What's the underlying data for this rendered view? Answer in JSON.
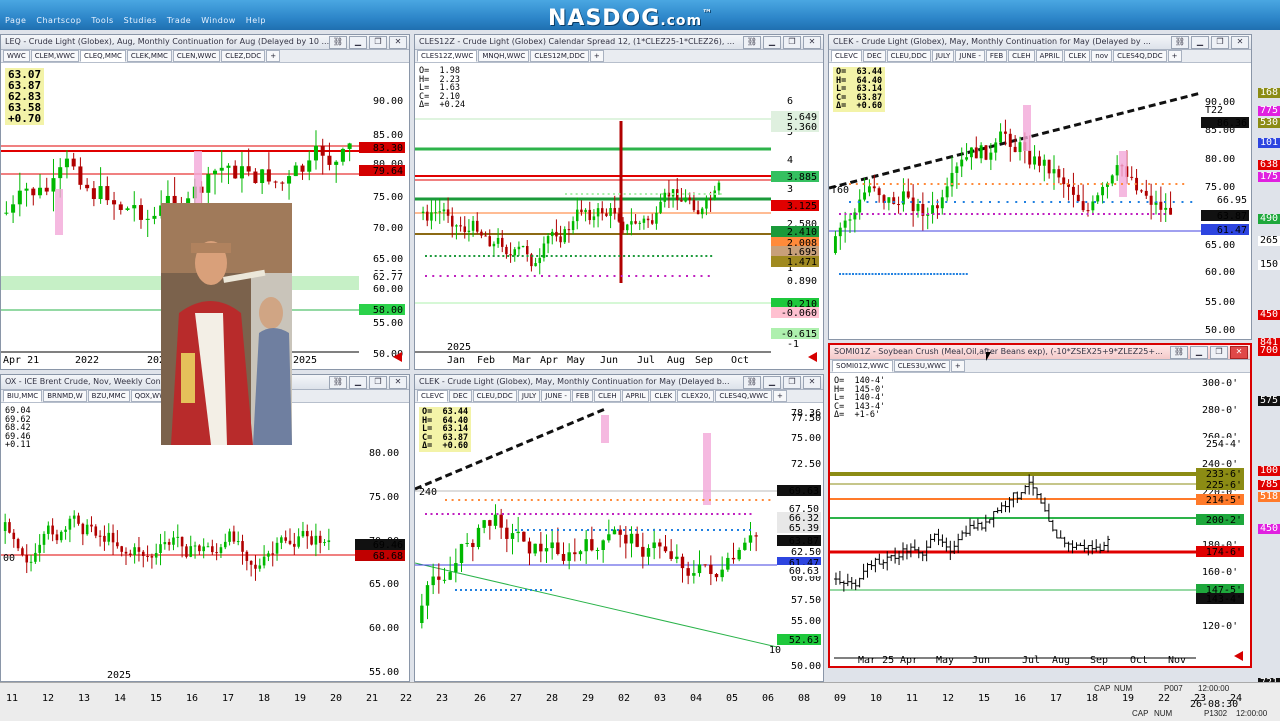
{
  "banner": {
    "logo_main": "NASDOG",
    "logo_suffix": ".com",
    "logo_tm": "™",
    "menu": [
      "Page",
      "Chartscop",
      "Tools",
      "Studies",
      "Trade",
      "Window",
      "Help"
    ]
  },
  "colors": {
    "up_candle": "#00c800",
    "down_candle": "#c80000",
    "red_line": "#e00000",
    "green_band": "#2db34a",
    "olive": "#8c8c14",
    "orange": "#ff7a2a",
    "blue_line": "#4040e0"
  },
  "windows": [
    {
      "id": "w1",
      "title": "LEQ - Crude Light (Globex), Aug, Monthly Continuation for Aug (Delayed by 10 ...",
      "tabs": [
        "WWC",
        "CLEM,WWC",
        "CLEQ,MMC",
        "CLEK,MMC",
        "CLEN,WWC",
        "CLEZ,DDC",
        "+"
      ],
      "ohlc": [
        "63.07",
        "63.87",
        "62.83",
        "63.58",
        "+0.70"
      ],
      "y_ticks": [
        "90.00",
        "85.00",
        "80.00",
        "75.00",
        "70.00",
        "65.00",
        "60.00",
        "55.00",
        "50.00"
      ],
      "right_labels": [
        {
          "text": "83.30",
          "color": "#d40000"
        },
        {
          "text": "79.64",
          "color": "#d40000"
        },
        {
          "text": "62.59",
          "color": "#111"
        },
        {
          "text": "62.77",
          "color": "#5a5a5a"
        },
        {
          "text": "58.00",
          "color": "#1eaa3c"
        }
      ],
      "x_labels": [
        "Apr 21",
        "2022",
        "202",
        "2025"
      ]
    },
    {
      "id": "w2",
      "title": "CLES12Z - Crude Light (Globex) Calendar Spread 12, (1*CLEZ25-1*CLEZ26), ...",
      "tabs": [
        "CLES12Z,WWC",
        "MNQH,WWC",
        "CLES12M,DDC",
        "+"
      ],
      "ohlc": [
        "O=  1.98",
        "H=  2.23",
        "L=  1.63",
        "C=  2.10",
        "Δ=  +0.24"
      ],
      "y_ticks": [
        "6",
        "5",
        "4",
        "3",
        "2",
        "1",
        "0",
        "-1"
      ],
      "right_labels": [
        {
          "text": "5.649",
          "color": "#000",
          "bg": "#dff0df"
        },
        {
          "text": "5.360",
          "color": "#000",
          "bg": "#dff0df"
        },
        {
          "text": "3.885",
          "color": "#000",
          "bg": "#35c060"
        },
        {
          "text": "3.125",
          "color": "#fff",
          "bg": "#e00000"
        },
        {
          "text": "2.580",
          "color": "#000",
          "bg": "#fff"
        },
        {
          "text": "2.410",
          "color": "#fff",
          "bg": "#1a9a3a"
        },
        {
          "text": "2.008",
          "color": "#000",
          "bg": "#ff8a3a"
        },
        {
          "text": "1.695",
          "color": "#000",
          "bg": "#c8a07a"
        },
        {
          "text": "1.471",
          "color": "#000",
          "bg": "#a08a20"
        },
        {
          "text": "0.890",
          "color": "#000",
          "bg": "#fff"
        },
        {
          "text": "0.210",
          "color": "#fff",
          "bg": "#1ec83c"
        },
        {
          "text": "-0.060",
          "color": "#000",
          "bg": "#ffc0d0"
        },
        {
          "text": "-0.615",
          "color": "#000",
          "bg": "#aef0ae"
        }
      ],
      "year": "2025",
      "x_labels": [
        "Jan",
        "Feb",
        "Mar",
        "Apr",
        "May",
        "Jun",
        "Jul",
        "Aug",
        "Sep",
        "Oct"
      ]
    },
    {
      "id": "w3",
      "title": "CLEK - Crude Light (Globex), May, Monthly Continuation for May (Delayed by ...",
      "tabs": [
        "CLEVC",
        "DEC",
        "CLEU,DDC",
        "JULY",
        "JUNE -",
        "FEB",
        "CLEH",
        "APRIL",
        "CLEK",
        "nov",
        "CLES4Q,DDC",
        "+"
      ],
      "ohlc": [
        "O=  63.44",
        "H=  64.40",
        "L=  63.14",
        "C=  63.87",
        "Δ=  +0.60"
      ],
      "y_ticks": [
        "90.00",
        "85.00",
        "80.00",
        "75.00",
        "70.00",
        "65.00",
        "60.00",
        "55.00",
        "50.00",
        "45.00"
      ],
      "right_labels": [
        {
          "text": "86.36",
          "color": "#fff",
          "bg": "#111"
        },
        {
          "text": "66.95",
          "color": "#1a5ad0",
          "bg": "#fff"
        },
        {
          "text": "63.87",
          "color": "#fff",
          "bg": "#111"
        },
        {
          "text": "61.47",
          "color": "#fff",
          "bg": "#2d45e0"
        }
      ],
      "edge_labels": [
        "T22",
        "T60"
      ]
    },
    {
      "id": "w4",
      "title": "OX - ICE Brent Crude, Nov, Weekly Continuation",
      "tabs": [
        "BIU,MMC",
        "BRNMD,W",
        "BZU,MMC",
        "QOX,WWC",
        "+"
      ],
      "ohlc": [
        "69.04",
        "69.62",
        "68.42",
        "69.46",
        "+0.11"
      ],
      "y_ticks": [
        "80.00",
        "75.00",
        "70.00",
        "65.00",
        "60.00",
        "55.00"
      ],
      "right_labels": [
        {
          "text": "69.46",
          "color": "#fff",
          "bg": "#111"
        },
        {
          "text": "68.68",
          "color": "#fff",
          "bg": "#c00000"
        }
      ],
      "year": "2025",
      "edge_label": "00"
    },
    {
      "id": "w5",
      "title": "CLEK - Crude Light (Globex), May, Monthly Continuation for May (Delayed b...",
      "tabs": [
        "CLEVC",
        "DEC",
        "CLEU,DDC",
        "JULY",
        "JUNE -",
        "FEB",
        "CLEH",
        "APRIL",
        "CLEK",
        "CLEX20,",
        "CLES4Q,WWC",
        "+"
      ],
      "ohlc": [
        "O=  63.44",
        "H=  64.40",
        "L=  63.14",
        "C=  63.87",
        "Δ=  +0.60"
      ],
      "y_ticks": [
        "78.36",
        "77.50",
        "75.00",
        "72.50",
        "70.00",
        "67.50",
        "65.00",
        "62.50",
        "60.00",
        "57.50",
        "55.00",
        "52.50",
        "50.00"
      ],
      "right_labels": [
        {
          "text": "69.63",
          "color": "#fff",
          "bg": "#111"
        },
        {
          "text": "67.50",
          "color": "#1a5ad0",
          "bg": "#fff"
        },
        {
          "text": "66.32",
          "color": "#000",
          "bg": "#e8e8e8"
        },
        {
          "text": "65.39",
          "color": "#000",
          "bg": "#e8e8e8"
        },
        {
          "text": "63.87",
          "color": "#fff",
          "bg": "#111"
        },
        {
          "text": "61.47",
          "color": "#fff",
          "bg": "#2d45e0"
        },
        {
          "text": "60.63",
          "color": "#000",
          "bg": "#fff"
        },
        {
          "text": "52.63",
          "color": "#fff",
          "bg": "#1ec83c"
        }
      ],
      "edge_labels": [
        "240",
        "10"
      ]
    },
    {
      "id": "w6",
      "title": "SOMI01Z - Soybean Crush (Meal,Oil,after Beans exp), (-10*ZSEX25+9*ZLEZ25+...",
      "tabs": [
        "SOMI01Z,WWC",
        "CLES3U,WWC",
        "+"
      ],
      "ohlc": [
        "O=  140-4'",
        "H=  145-0'",
        "L=  140-4'",
        "C=  143-4'",
        "Δ=  +1-6'"
      ],
      "y_ticks": [
        "300-0'",
        "280-0'",
        "260-0'",
        "240-0'",
        "220-0'",
        "200-0'",
        "180-0'",
        "160-0'",
        "140-0'",
        "120-0'"
      ],
      "right_labels": [
        {
          "text": "254-4'",
          "color": "#000",
          "bg": "#fff"
        },
        {
          "text": "233-6'",
          "color": "#fff",
          "bg": "#8c8c14"
        },
        {
          "text": "225-6'",
          "color": "#fff",
          "bg": "#8c8c14"
        },
        {
          "text": "214-5'",
          "color": "#000",
          "bg": "#ff7a2a"
        },
        {
          "text": "200-2'",
          "color": "#fff",
          "bg": "#1ea83c"
        },
        {
          "text": "174-6'",
          "color": "#fff",
          "bg": "#e00000"
        },
        {
          "text": "147-5'",
          "color": "#fff",
          "bg": "#1ea83c"
        },
        {
          "text": "143-4'",
          "color": "#fff",
          "bg": "#111"
        }
      ],
      "x_labels": [
        "Mar 25",
        "Apr",
        "May",
        "Jun",
        "Jul",
        "Aug",
        "Sep",
        "Oct",
        "Nov"
      ]
    }
  ],
  "far_right_labels": [
    {
      "text": "168",
      "bg": "#8c8c14"
    },
    {
      "text": "775",
      "bg": "#e020e0"
    },
    {
      "text": "530",
      "bg": "#8c8c14"
    },
    {
      "text": "101",
      "bg": "#2d45e0"
    },
    {
      "text": "638",
      "bg": "#e00000"
    },
    {
      "text": "175",
      "bg": "#e020e0"
    },
    {
      "text": "490",
      "bg": "#1ea83c"
    },
    {
      "text": "265",
      "bg": "#ffffff"
    },
    {
      "text": "150",
      "bg": "#ffffff"
    },
    {
      "text": "450",
      "bg": "#e00000"
    },
    {
      "text": "841",
      "bg": "#e00000"
    },
    {
      "text": "700",
      "bg": "#e00000"
    },
    {
      "text": "575",
      "bg": "#111"
    },
    {
      "text": "100",
      "bg": "#e00000"
    },
    {
      "text": "785",
      "bg": "#e00000"
    },
    {
      "text": "518",
      "bg": "#ff7a2a"
    },
    {
      "text": "450",
      "bg": "#e020e0"
    },
    {
      "text": "721",
      "bg": "#111"
    }
  ],
  "bottom_axis": [
    "11",
    "12",
    "13",
    "14",
    "15",
    "16",
    "17",
    "18",
    "19",
    "20",
    "21",
    "22",
    "23",
    "26",
    "27",
    "28",
    "29",
    "02",
    "03",
    "04",
    "05",
    "06",
    "08",
    "09",
    "10",
    "11",
    "12",
    "15",
    "16",
    "17",
    "18",
    "19",
    "22",
    "23",
    "24",
    "25",
    "26-08:30"
  ],
  "status": {
    "cap": "CAP",
    "num": "NUM",
    "p1": "P007",
    "time1": "12:00:00",
    "p2": "P1302",
    "time2": "12:00:00"
  }
}
